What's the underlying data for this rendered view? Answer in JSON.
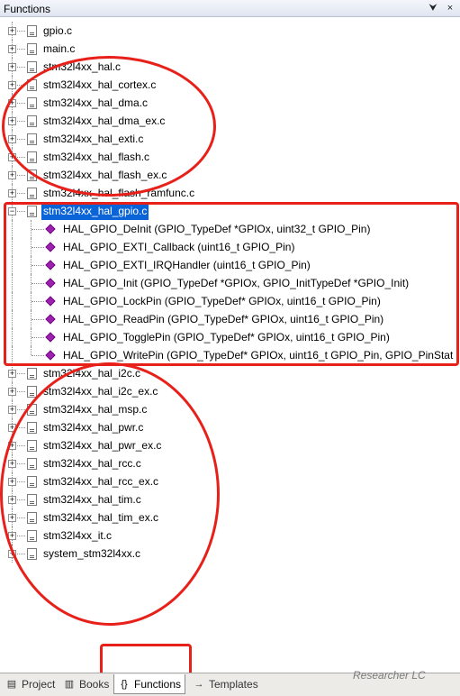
{
  "panel": {
    "title": "Functions",
    "pin_glyph": "⮟",
    "close_glyph": "×"
  },
  "files_before": [
    {
      "label": "gpio.c"
    },
    {
      "label": "main.c"
    },
    {
      "label": "stm32l4xx_hal.c"
    },
    {
      "label": "stm32l4xx_hal_cortex.c"
    },
    {
      "label": "stm32l4xx_hal_dma.c"
    },
    {
      "label": "stm32l4xx_hal_dma_ex.c"
    },
    {
      "label": "stm32l4xx_hal_exti.c"
    },
    {
      "label": "stm32l4xx_hal_flash.c"
    },
    {
      "label": "stm32l4xx_hal_flash_ex.c"
    },
    {
      "label": "stm32l4xx_hal_flash_ramfunc.c"
    }
  ],
  "expanded_file": {
    "label": "stm32l4xx_hal_gpio.c",
    "functions": [
      "HAL_GPIO_DeInit (GPIO_TypeDef *GPIOx, uint32_t GPIO_Pin)",
      "HAL_GPIO_EXTI_Callback (uint16_t GPIO_Pin)",
      "HAL_GPIO_EXTI_IRQHandler (uint16_t GPIO_Pin)",
      "HAL_GPIO_Init (GPIO_TypeDef *GPIOx, GPIO_InitTypeDef *GPIO_Init)",
      "HAL_GPIO_LockPin (GPIO_TypeDef* GPIOx, uint16_t GPIO_Pin)",
      "HAL_GPIO_ReadPin (GPIO_TypeDef* GPIOx, uint16_t GPIO_Pin)",
      "HAL_GPIO_TogglePin (GPIO_TypeDef* GPIOx, uint16_t GPIO_Pin)",
      "HAL_GPIO_WritePin (GPIO_TypeDef* GPIOx, uint16_t GPIO_Pin, GPIO_PinStat"
    ]
  },
  "files_after": [
    {
      "label": "stm32l4xx_hal_i2c.c"
    },
    {
      "label": "stm32l4xx_hal_i2c_ex.c"
    },
    {
      "label": "stm32l4xx_hal_msp.c"
    },
    {
      "label": "stm32l4xx_hal_pwr.c"
    },
    {
      "label": "stm32l4xx_hal_pwr_ex.c"
    },
    {
      "label": "stm32l4xx_hal_rcc.c"
    },
    {
      "label": "stm32l4xx_hal_rcc_ex.c"
    },
    {
      "label": "stm32l4xx_hal_tim.c"
    },
    {
      "label": "stm32l4xx_hal_tim_ex.c"
    },
    {
      "label": "stm32l4xx_it.c"
    },
    {
      "label": "system_stm32l4xx.c"
    }
  ],
  "tabs": [
    {
      "label": "Project",
      "icon": "▤",
      "active": false
    },
    {
      "label": "Books",
      "icon": "▥",
      "active": false
    },
    {
      "label": "Functions",
      "icon": "{}",
      "active": true
    },
    {
      "label": "Templates",
      "icon": "→",
      "active": false
    }
  ],
  "watermark": "Researcher LC",
  "colors": {
    "annotation": "#e8201a",
    "selection": "#0a64d8",
    "function_icon": "#a01fb3"
  }
}
